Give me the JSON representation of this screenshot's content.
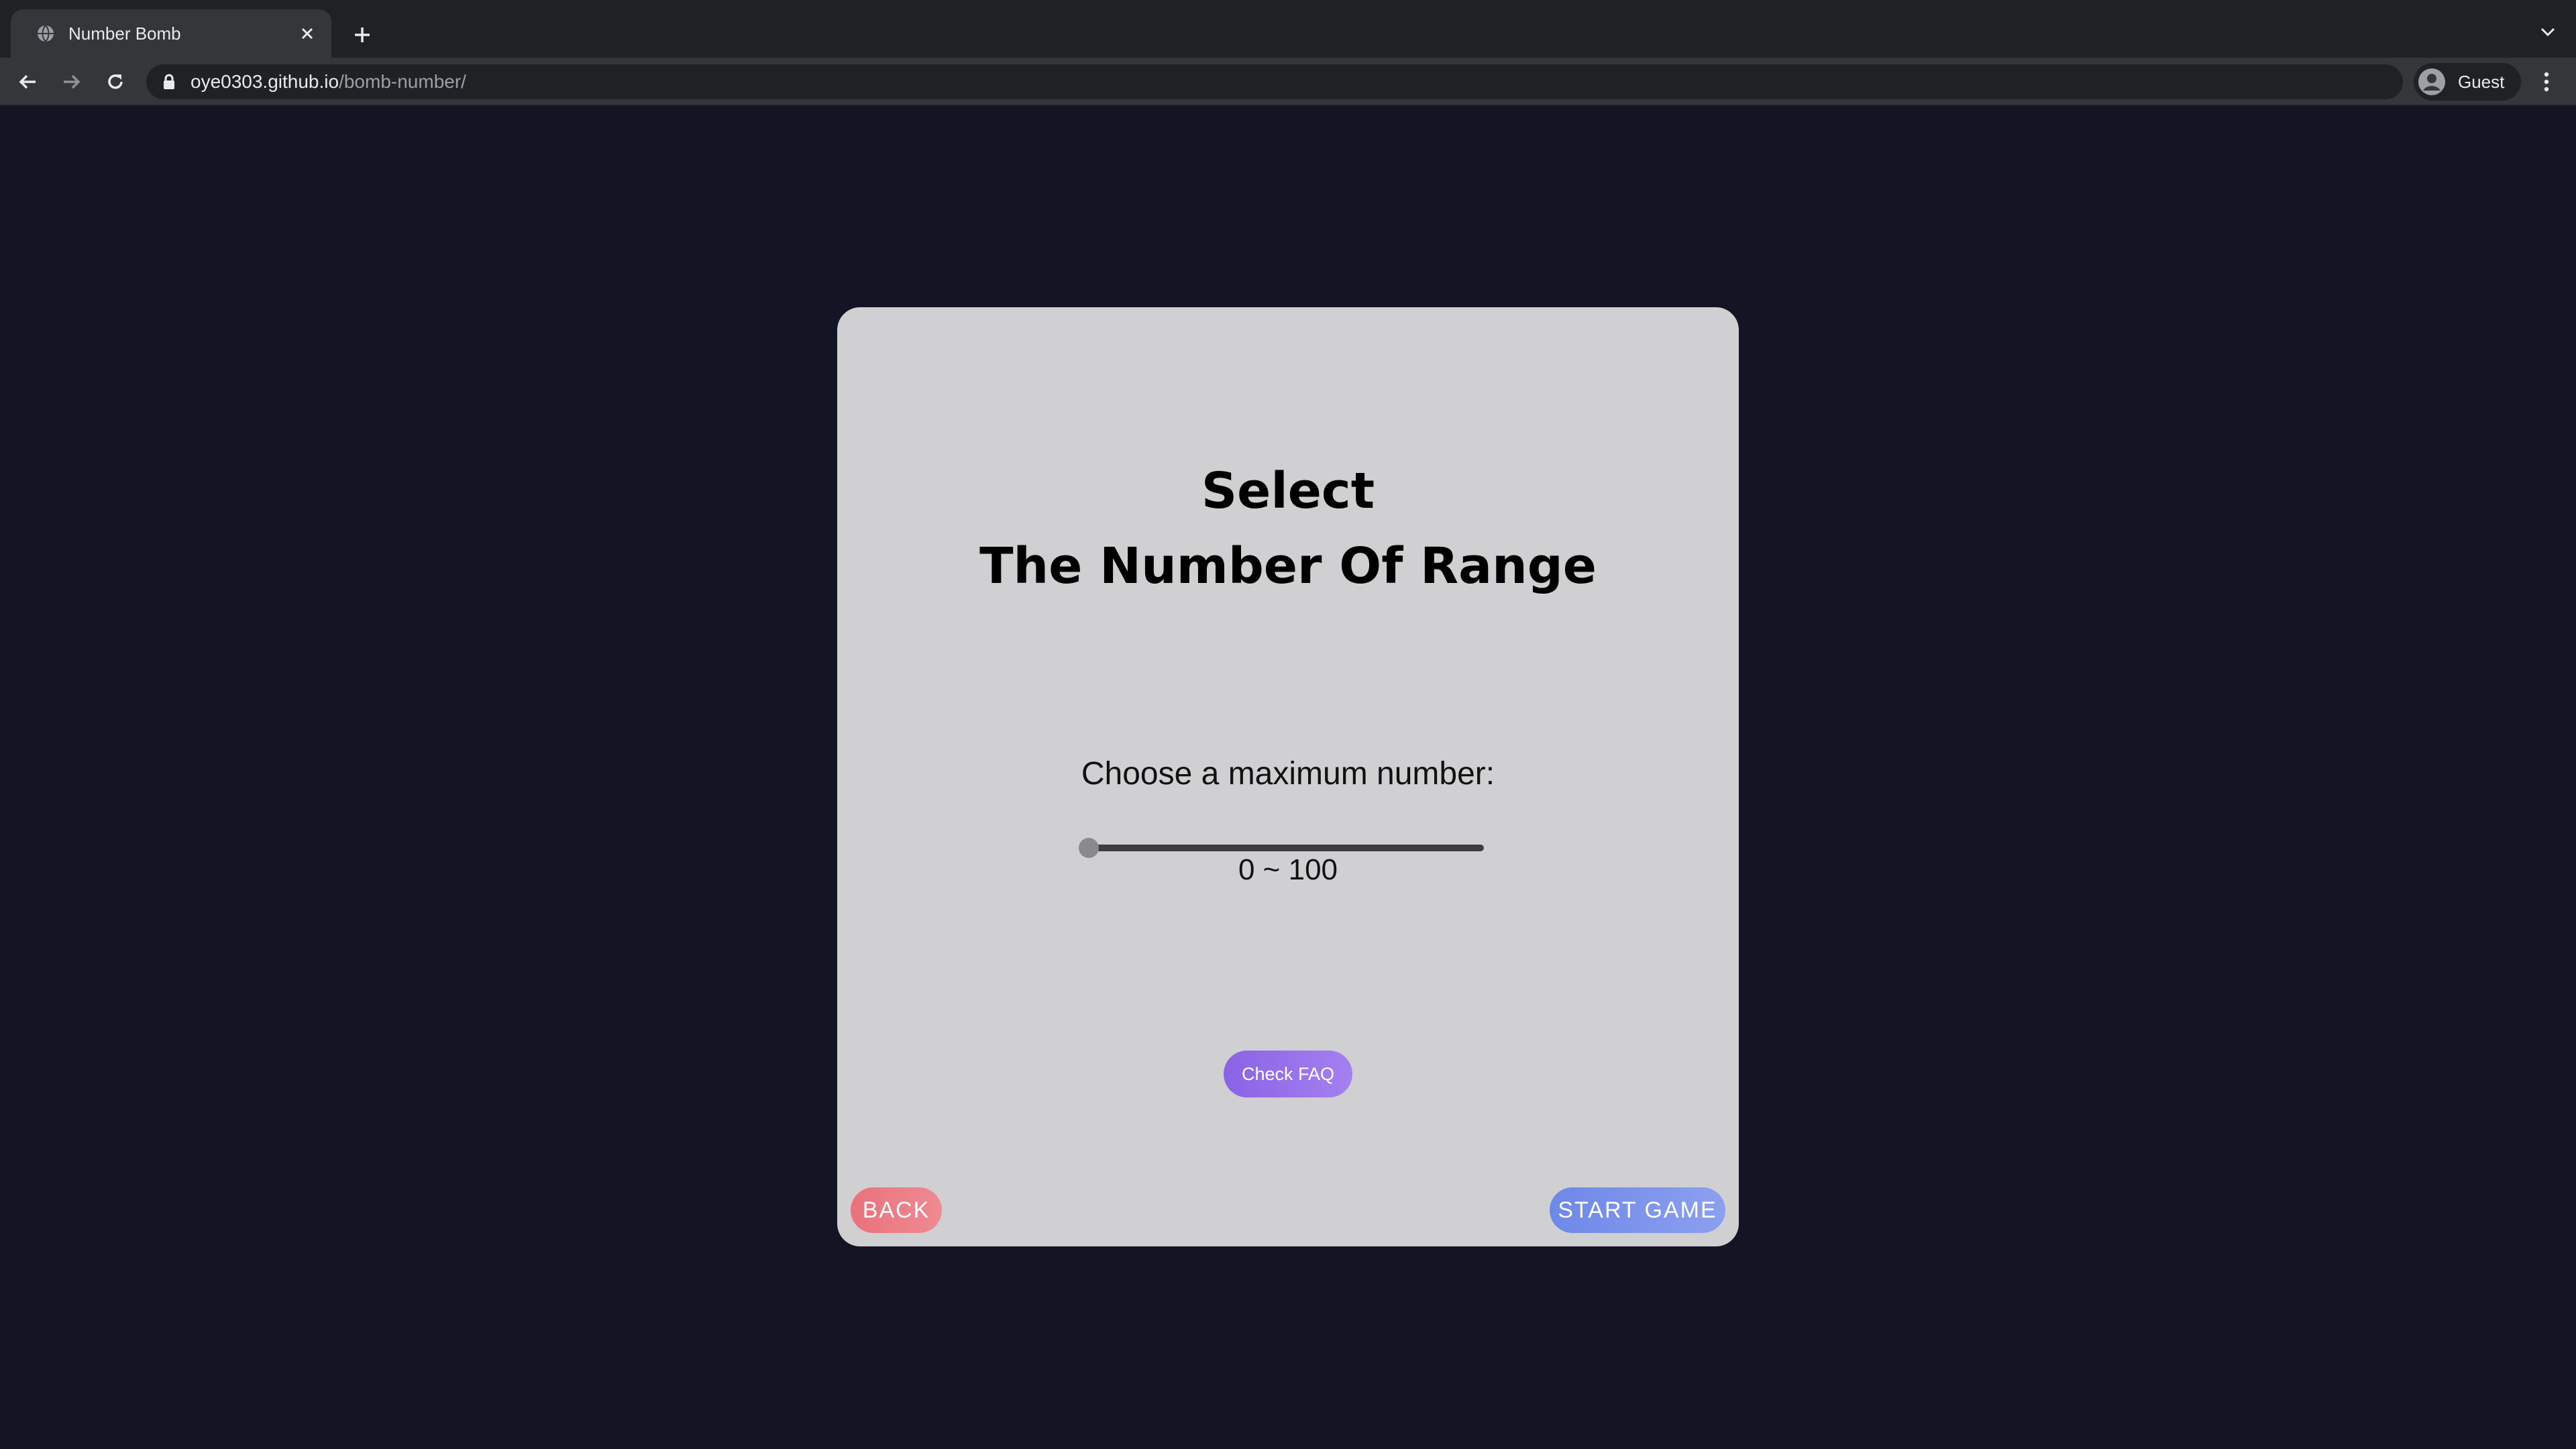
{
  "browser": {
    "tab": {
      "title": "Number Bomb",
      "favicon": "globe-icon"
    },
    "new_tab_icon": "plus-icon",
    "address": {
      "domain": "oye0303.github.io",
      "path": "/bomb-number/"
    },
    "profile": {
      "label": "Guest"
    }
  },
  "page": {
    "heading": {
      "line1": "Select",
      "line2": "The Number Of Range"
    },
    "range_label": "Choose a maximum number:",
    "slider": {
      "min": 0,
      "max": 100,
      "value": 0
    },
    "range_value": "0 ~ 100",
    "faq_button": "Check FAQ",
    "back_button": "BACK",
    "start_button": "START GAME"
  },
  "colors": {
    "background": "#131524",
    "card": "#d0d0d3",
    "faq": "#8a63e6",
    "back": "#e9727c",
    "start": "#6e88e8"
  }
}
